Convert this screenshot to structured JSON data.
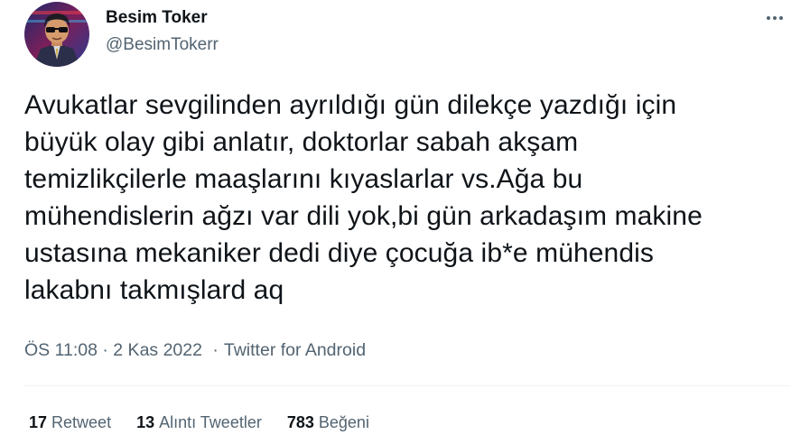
{
  "author": {
    "display_name": "Besim Toker",
    "handle": "@BesimTokerr"
  },
  "tweet": {
    "text": "Avukatlar sevgilinden ayrıldığı gün dilekçe yazdığı için\nbüyük olay gibi anlatır, doktorlar sabah akşam\ntemizlikçilerle maaşlarını kıyaslarlar vs.Ağa bu\nmühendislerin ağzı var dili yok,bi gün arkadaşım makine\nustasına mekaniker dedi diye çocuğa ib*e mühendis\nlakabnı takmışlard aq"
  },
  "meta": {
    "time": "ÖS 11:08",
    "date": "2 Kas 2022",
    "separator": "·",
    "source": "Twitter for Android"
  },
  "stats": [
    {
      "count": "17",
      "label": "Retweet"
    },
    {
      "count": "13",
      "label": "Alıntı Tweetler"
    },
    {
      "count": "783",
      "label": "Beğeni"
    }
  ],
  "colors": {
    "text_primary": "#0f1419",
    "text_secondary": "#536471",
    "divider": "#eff3f4"
  },
  "icons": {
    "more": "more-horizontal-icon"
  }
}
